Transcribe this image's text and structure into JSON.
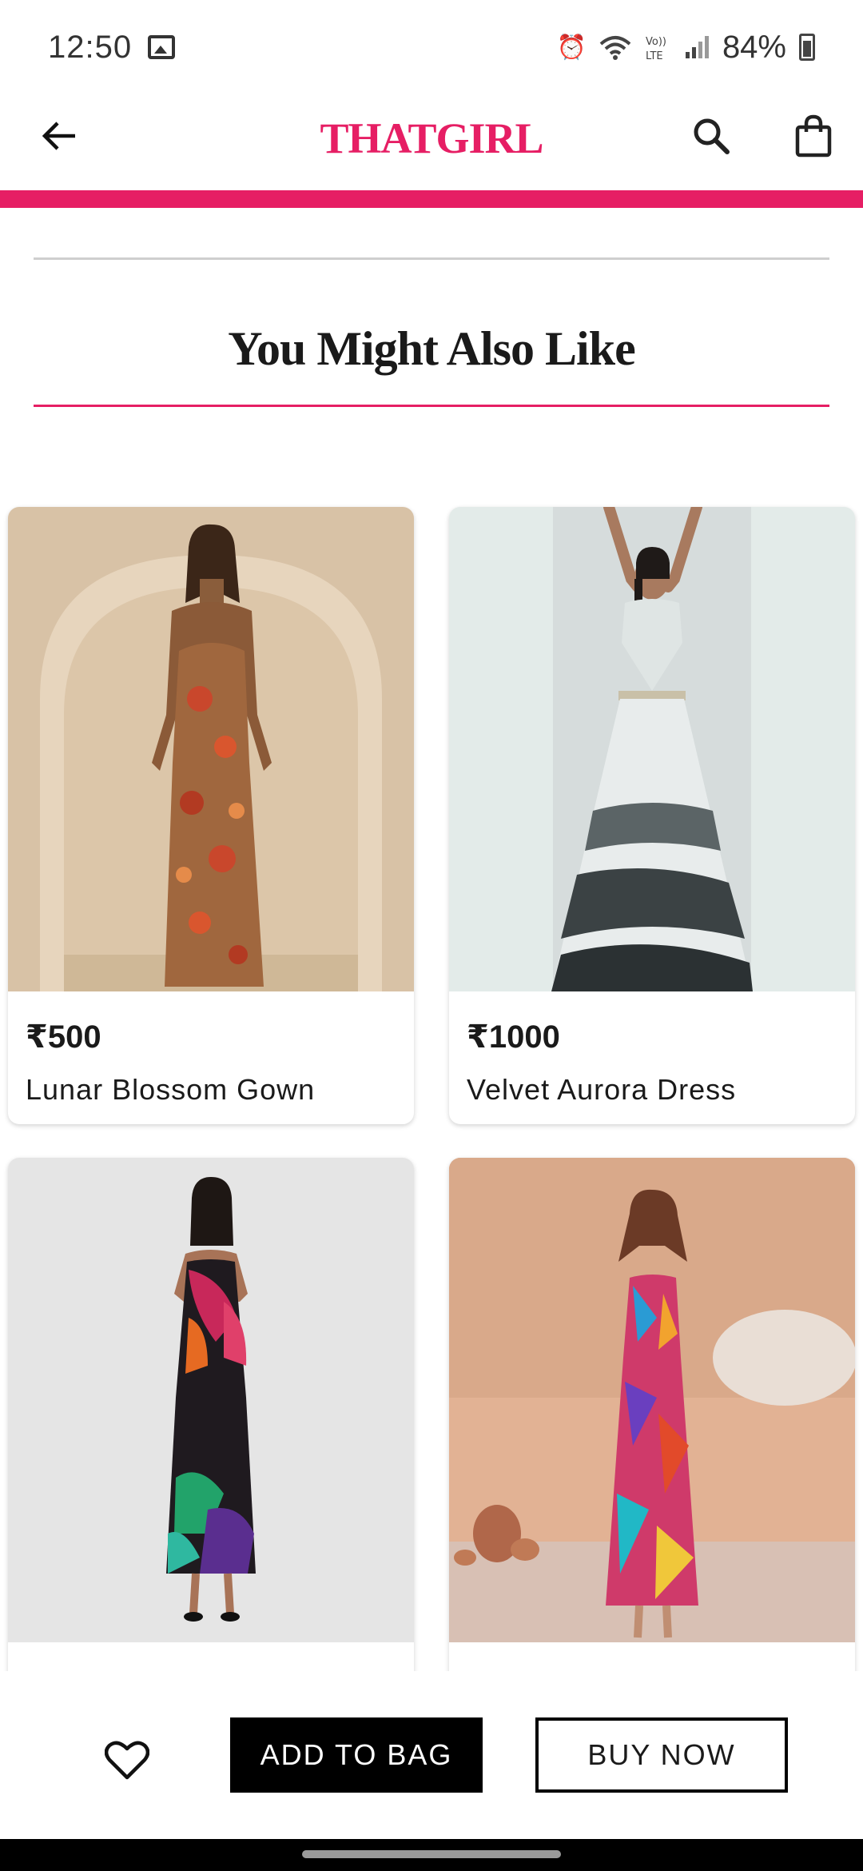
{
  "status_bar": {
    "time": "12:50",
    "icons": [
      "gallery-icon",
      "alarm-icon",
      "wifi-icon",
      "volte-icon",
      "signal-icon",
      "battery-icon"
    ],
    "battery_percent": "84%"
  },
  "header": {
    "brand": "THATGIRL",
    "brand_color": "#e61e64",
    "icons": [
      "back-arrow-icon",
      "search-icon",
      "shopping-bag-icon"
    ]
  },
  "section": {
    "title": "You Might Also Like"
  },
  "products": [
    {
      "price": "₹500",
      "name": "Lunar Blossom Gown"
    },
    {
      "price": "₹1000",
      "name": "Velvet Aurora Dress"
    },
    {
      "price": "",
      "name": ""
    },
    {
      "price": "",
      "name": ""
    }
  ],
  "actions": {
    "wishlist_icon": "heart-icon",
    "add_to_bag": "ADD TO BAG",
    "buy_now": "BUY NOW"
  }
}
